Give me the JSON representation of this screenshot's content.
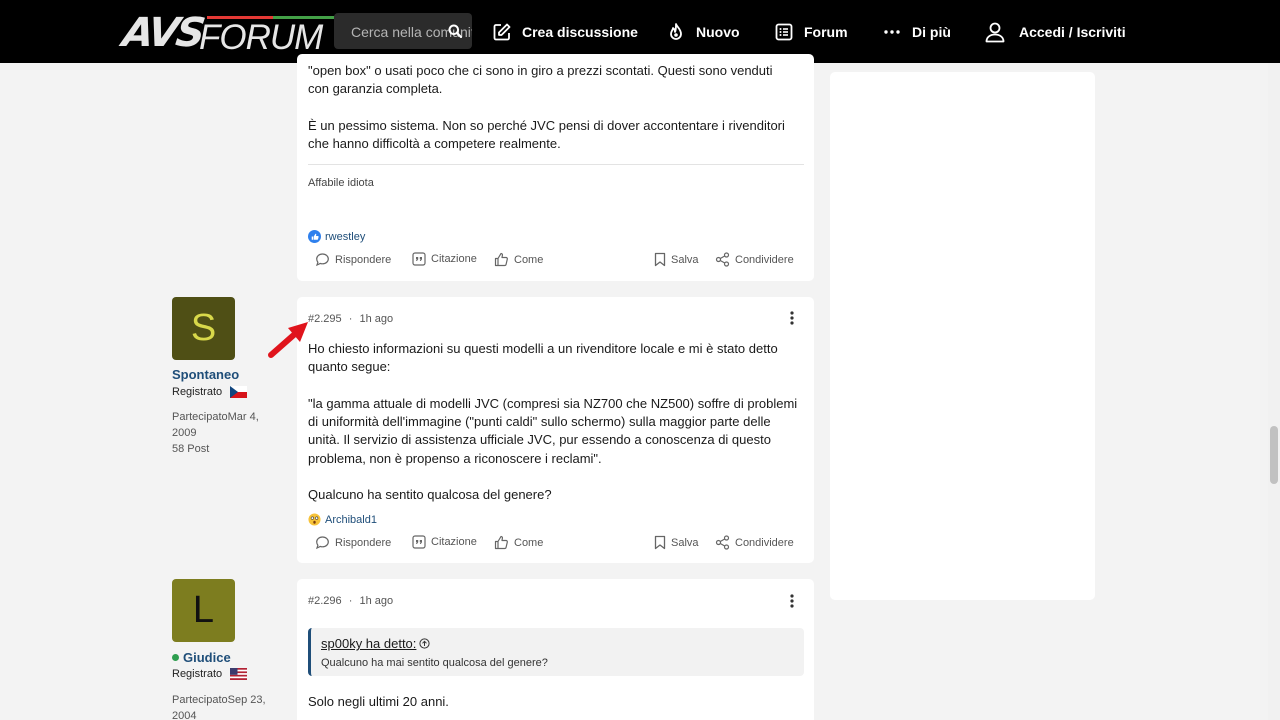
{
  "header": {
    "logo_avs": "AVS",
    "logo_forum": "FORUM",
    "search_placeholder": "Cerca nella comunità",
    "nav": {
      "create": "Crea discussione",
      "new": "Nuovo",
      "forum": "Forum",
      "more": "Di più",
      "login": "Accedi / Iscriviti"
    }
  },
  "colors": {
    "header_bg": "#000000",
    "link": "#1f4e79",
    "online": "#2e9e4f",
    "arrow": "#e0141c"
  },
  "post_prev": {
    "lines": [
      "\"open box\" o usati poco che ci sono in giro a prezzi scontati. Questi sono venduti",
      "con garanzia completa.",
      "",
      "È un pessimo sistema. Non so perché JVC pensi di dover accontentare i rivenditori",
      "che hanno difficoltà a competere realmente."
    ],
    "signature": "Affabile idiota",
    "reaction_user": "rwestley",
    "reaction_icon": "thumbs-up-icon"
  },
  "actions": {
    "reply": "Rispondere",
    "quote": "Citazione",
    "like": "Come",
    "save": "Salva",
    "share": "Condividere"
  },
  "post_2295": {
    "number": "#2.295",
    "separator": "·",
    "time": "1h ago",
    "author": {
      "initial": "S",
      "name": "Spontaneo",
      "role": "Registrato",
      "flag": "czech-flag-icon",
      "joined_line1": "PartecipatoMar 4,",
      "joined_line2": "2009",
      "posts": "58 Post",
      "avatar_color": "#4f4f15",
      "initial_color": "#d8d84a"
    },
    "lines": [
      "Ho chiesto informazioni su questi modelli a un rivenditore locale e mi è stato detto",
      "quanto segue:",
      "",
      "\"la gamma attuale di modelli JVC (compresi sia NZ700 che NZ500) soffre di problemi",
      "di uniformità dell'immagine (\"punti caldi\" sullo schermo) sulla maggior parte delle",
      "unità. Il servizio di assistenza ufficiale JVC, pur essendo a conoscenza di questo",
      "problema, non è propenso a riconoscere i reclami\".",
      "",
      "Qualcuno ha sentito qualcosa del genere?"
    ],
    "reaction_user": "Archibald1",
    "reaction_icon": "astonished-face-icon"
  },
  "post_2296": {
    "number": "#2.296",
    "separator": "·",
    "time": "1h ago",
    "author": {
      "initial": "L",
      "name": "Giudice",
      "role": "Registrato",
      "flag": "usa-flag-icon",
      "joined_line1": "PartecipatoSep 23,",
      "joined_line2": "2004",
      "avatar_color": "#7d7d1f",
      "initial_color": "#111111"
    },
    "quote_author": "sp00ky ha detto:",
    "quote_text": "Qualcuno ha mai sentito qualcosa del genere?",
    "body": "Solo negli ultimi 20 anni."
  }
}
